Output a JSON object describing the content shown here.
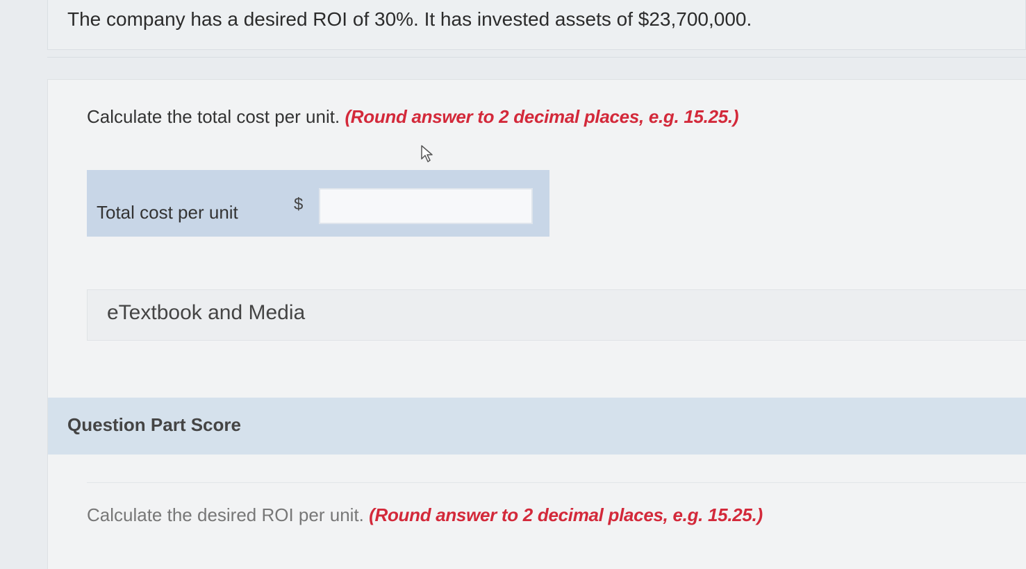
{
  "intro": {
    "text": "The company has a desired ROI of 30%. It has invested assets of $23,700,000."
  },
  "part1": {
    "question": "Calculate the total cost per unit.",
    "hint": "(Round answer to 2 decimal places, e.g. 15.25.)",
    "answer_label": "Total cost per unit",
    "currency_symbol": "$",
    "answer_value": ""
  },
  "etextbook": {
    "label": "eTextbook and Media"
  },
  "score": {
    "label": "Question Part Score"
  },
  "part2": {
    "question": "Calculate the desired ROI per unit.",
    "hint": "(Round answer to 2 decimal places, e.g. 15.25.)"
  },
  "colors": {
    "hint_red": "#d3293a",
    "answer_box_blue": "#c8d6e7",
    "score_bar_blue": "#d5e1ec"
  }
}
